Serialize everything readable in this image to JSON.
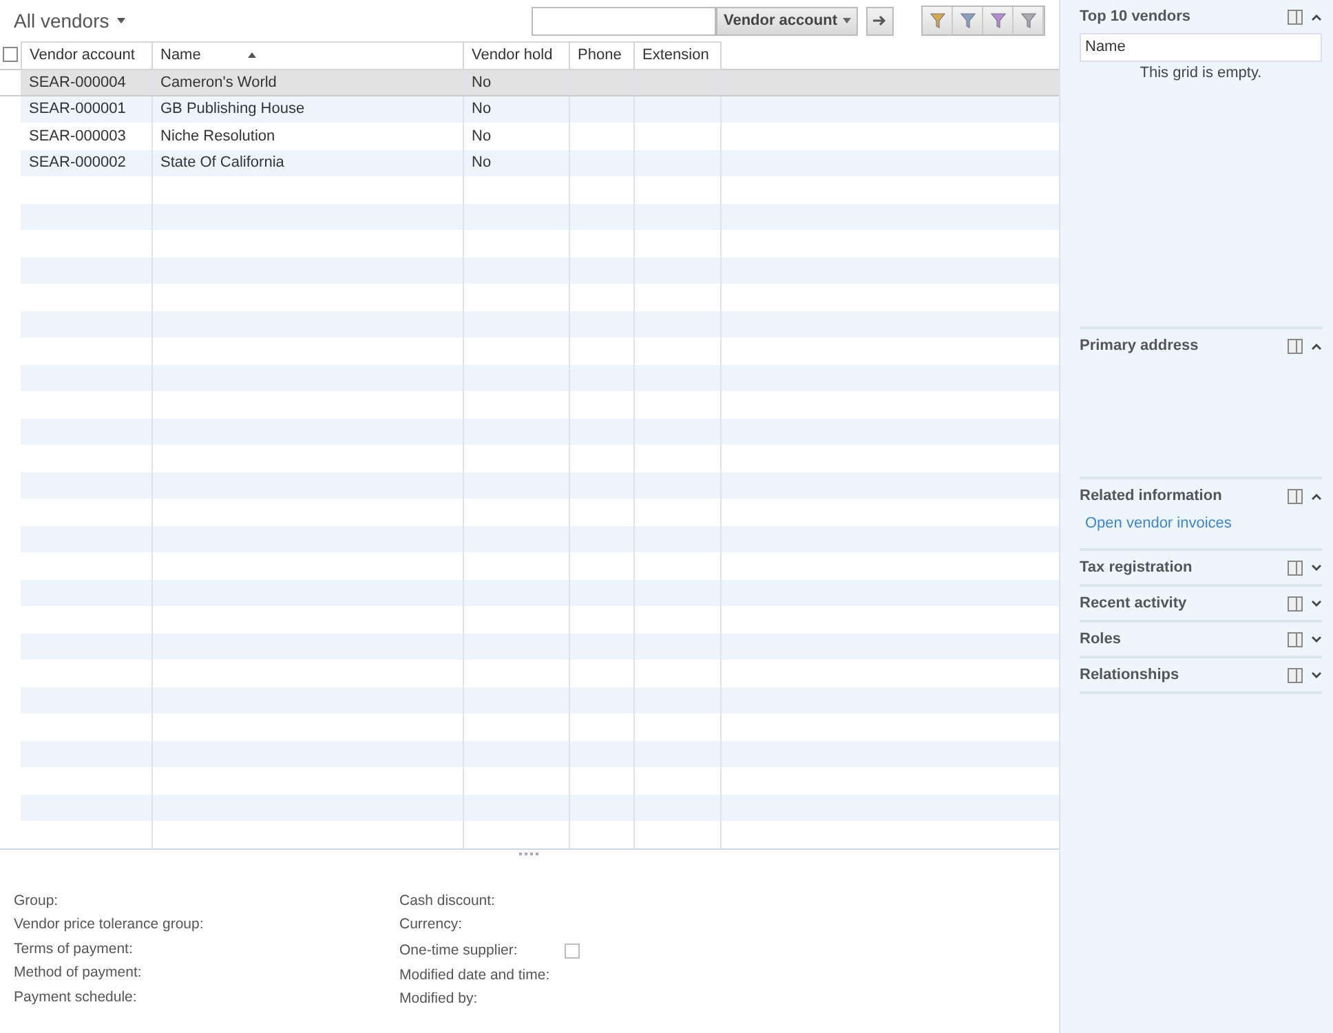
{
  "view": {
    "title": "All vendors"
  },
  "toolbar": {
    "field_selector": "Vendor account"
  },
  "grid": {
    "header_checkbox": {
      "checked": false
    },
    "columns": [
      {
        "label": "Vendor account",
        "sorted": false
      },
      {
        "label": "Name",
        "sorted": true
      },
      {
        "label": "Vendor hold",
        "sorted": false
      },
      {
        "label": "Phone",
        "sorted": false
      },
      {
        "label": "Extension",
        "sorted": false
      }
    ],
    "rows": [
      {
        "cells": [
          "SEAR-000004",
          "Cameron's World",
          "No",
          "",
          ""
        ],
        "selected": true
      },
      {
        "cells": [
          "SEAR-000001",
          "GB Publishing House",
          "No",
          "",
          ""
        ],
        "selected": false
      },
      {
        "cells": [
          "SEAR-000003",
          "Niche Resolution",
          "No",
          "",
          ""
        ],
        "selected": false
      },
      {
        "cells": [
          "SEAR-000002",
          "State Of California",
          "No",
          "",
          ""
        ],
        "selected": false
      }
    ]
  },
  "details": {
    "left": [
      {
        "label": "Group:",
        "kind": "text"
      },
      {
        "label": "Vendor price tolerance group:",
        "kind": "text"
      },
      {
        "label": "Terms of payment:",
        "kind": "text"
      },
      {
        "label": "Method of payment:",
        "kind": "text"
      },
      {
        "label": "Payment schedule:",
        "kind": "text"
      }
    ],
    "right": [
      {
        "label": "Cash discount:",
        "kind": "text"
      },
      {
        "label": "Currency:",
        "kind": "text"
      },
      {
        "label": "One-time supplier:",
        "kind": "checkbox",
        "checked": false
      },
      {
        "label": "Modified date and time:",
        "kind": "text"
      },
      {
        "label": "Modified by:",
        "kind": "text"
      }
    ]
  },
  "factboxes": [
    {
      "title": "Top 10 vendors",
      "expanded": true,
      "kind": "grid",
      "columns": [
        "Name"
      ],
      "empty_text": "This grid is empty."
    },
    {
      "title": "Primary address",
      "expanded": true,
      "kind": "blank"
    },
    {
      "title": "Related information",
      "expanded": true,
      "kind": "links",
      "links": [
        "Open vendor invoices"
      ]
    },
    {
      "title": "Tax registration",
      "expanded": false
    },
    {
      "title": "Recent activity",
      "expanded": false
    },
    {
      "title": "Roles",
      "expanded": false
    },
    {
      "title": "Relationships",
      "expanded": false
    }
  ]
}
